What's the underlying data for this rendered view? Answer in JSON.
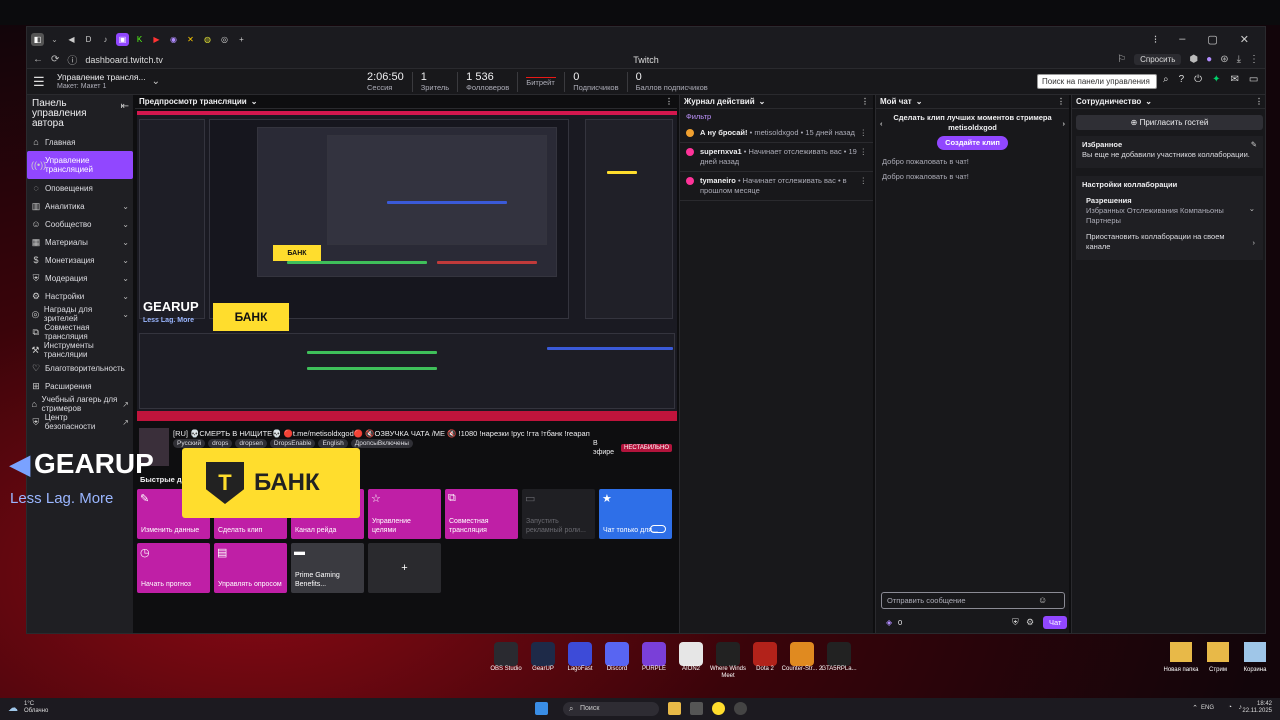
{
  "browser": {
    "url": "dashboard.twitch.tv",
    "title": "Twitch",
    "ask_label": "Спросить",
    "window_controls": [
      "⁝",
      "–",
      "▢",
      "✕"
    ]
  },
  "topbar": {
    "channel_name": "Управление трансля...",
    "channel_sub": "Макет: Макет 1",
    "stats": [
      {
        "value": "2:06:50",
        "label": "Сессия"
      },
      {
        "value": "1",
        "label": "Зритель"
      },
      {
        "value": "1 536",
        "label": "Фолловеров"
      },
      {
        "value": "",
        "label": "Битрейт"
      },
      {
        "value": "0",
        "label": "Подписчиков"
      },
      {
        "value": "0",
        "label": "Баллов подписчиков"
      }
    ],
    "search_placeholder": "Поиск на панели управления"
  },
  "sidebar": {
    "title": "Панель управления автора",
    "items": [
      {
        "label": "Главная",
        "icon": "home-icon",
        "glyph": "⌂",
        "chevron": false,
        "external": false
      },
      {
        "label": "Управление трансляцией",
        "icon": "broadcast-icon",
        "glyph": "((•))",
        "chevron": false,
        "external": false,
        "active": true
      },
      {
        "label": "Оповещения",
        "icon": "alert-icon",
        "glyph": "◌",
        "chevron": false,
        "external": false
      },
      {
        "label": "Аналитика",
        "icon": "analytics-icon",
        "glyph": "▥",
        "chevron": true,
        "external": false
      },
      {
        "label": "Сообщество",
        "icon": "community-icon",
        "glyph": "☺",
        "chevron": true,
        "external": false
      },
      {
        "label": "Материалы",
        "icon": "content-icon",
        "glyph": "▦",
        "chevron": true,
        "external": false
      },
      {
        "label": "Монетизация",
        "icon": "monetize-icon",
        "glyph": "$",
        "chevron": true,
        "external": false
      },
      {
        "label": "Модерация",
        "icon": "moderation-icon",
        "glyph": "⛨",
        "chevron": true,
        "external": false
      },
      {
        "label": "Настройки",
        "icon": "settings-icon",
        "glyph": "⚙",
        "chevron": true,
        "external": false
      },
      {
        "label": "Награды для зрителей",
        "icon": "rewards-icon",
        "glyph": "◎",
        "chevron": true,
        "external": false
      },
      {
        "label": "Совместная трансляция",
        "icon": "collab-icon",
        "glyph": "⧉",
        "chevron": false,
        "external": false
      },
      {
        "label": "Инструменты трансляции",
        "icon": "tools-icon",
        "glyph": "⚒",
        "chevron": false,
        "external": false
      },
      {
        "label": "Благотворительность",
        "icon": "charity-icon",
        "glyph": "♡",
        "chevron": false,
        "external": false
      },
      {
        "label": "Расширения",
        "icon": "extensions-icon",
        "glyph": "⊞",
        "chevron": false,
        "external": false
      },
      {
        "label": "Учебный лагерь для стримеров",
        "icon": "bootcamp-icon",
        "glyph": "⌂",
        "chevron": false,
        "external": true
      },
      {
        "label": "Центр безопасности",
        "icon": "safety-icon",
        "glyph": "⛨",
        "chevron": false,
        "external": true
      }
    ]
  },
  "preview": {
    "header": "Предпросмотр трансляции",
    "stream_title": "[RU] 💀СМЕРТЬ В НИЩИТЕ💀 🔴t.me/metisoldxgod🔴 🔇ОЗВУЧКА ЧАТА /МЕ 🔇 !1080 !нарезки !рус !гта !тбанк !геарап",
    "tags": [
      "Русский",
      "drops",
      "dropsen",
      "DropsEnable",
      "English",
      "ДропсыВключены"
    ],
    "status_line1": "В",
    "status_line2": "эфире",
    "unstable_label": "НЕСТАБИЛЬНО",
    "quick_actions_header": "Быстрые действия",
    "quick_actions": [
      {
        "label": "Изменить данные",
        "icon": "edit-icon",
        "glyph": "✎",
        "color": "#bf1fa6"
      },
      {
        "label": "Сделать клип",
        "icon": "clip-icon",
        "glyph": "✂",
        "color": "#bf1fa6"
      },
      {
        "label": "Канал рейда",
        "icon": "raid-icon",
        "glyph": "⇢",
        "color": "#bf1fa6"
      },
      {
        "label": "Управление целями",
        "icon": "goals-icon",
        "glyph": "☆",
        "color": "#bf1fa6"
      },
      {
        "label": "Совместная трансляция",
        "icon": "collab-icon",
        "glyph": "⧉",
        "color": "#bf1fa6"
      },
      {
        "label": "Запустить рекламный роли...",
        "icon": "ad-icon",
        "glyph": "▭",
        "color": "#1f1f23"
      },
      {
        "label": "Чат только для...",
        "icon": "star-icon",
        "glyph": "★",
        "color": "#2e6fe8"
      },
      {
        "label": "Начать прогноз",
        "icon": "prediction-icon",
        "glyph": "◷",
        "color": "#bf1fa6"
      },
      {
        "label": "Управлять опросом",
        "icon": "poll-icon",
        "glyph": "▤",
        "color": "#bf1fa6"
      },
      {
        "label": "Prime Gaming Benefits...",
        "icon": "prime-icon",
        "glyph": "▬",
        "color": "#3a3a40"
      },
      {
        "label": "+",
        "icon": "add-icon",
        "glyph": "+",
        "color": "#2a2a2e"
      }
    ]
  },
  "activity": {
    "header": "Журнал действий",
    "filter": "Фильтр",
    "items": [
      {
        "user": "А ну бросай!",
        "text": " • metisoldxgod • 15 дней назад",
        "icon_color": "#f0a030"
      },
      {
        "user": "supernxva1",
        "text": " • Начинает отслеживать вас • 19 дней назад",
        "icon_color": "#ff3399"
      },
      {
        "user": "tymaneiro",
        "text": " • Начинает отслеживать вас • в прошлом месяце",
        "icon_color": "#ff3399"
      }
    ]
  },
  "chat": {
    "header": "Мой чат",
    "clip_prompt": "Сделать клип лучших моментов стримера metisoldxgod",
    "clip_button": "Создайте клип",
    "welcome": [
      "Добро пожаловать в чат!",
      "Добро пожаловать в чат!"
    ],
    "input_placeholder": "Отправить сообщение",
    "points": "0",
    "send_label": "Чат"
  },
  "collab": {
    "header": "Сотрудничество",
    "invite": "Пригласить гостей",
    "favorites_title": "Избранное",
    "favorites_text": "Вы еще не добавили участников коллаборации.",
    "settings_title": "Настройки коллаборации",
    "perm_title": "Разрешения",
    "perm_text": "Избранных Отслеживания Компаньоны Партнеры",
    "pause_text": "Приостановить коллаборации на своем канале"
  },
  "overlay": {
    "gearup": "GEARUP",
    "gearup_slogan": "Less Lag. More",
    "tbank": "БАНК",
    "tbank_letter": "T"
  },
  "desktop": {
    "dock": [
      {
        "label": "OBS Studio",
        "color": "#2a2a30"
      },
      {
        "label": "GearUP",
        "color": "#1e2a48"
      },
      {
        "label": "LagoFast",
        "color": "#3d4bd8"
      },
      {
        "label": "Discord",
        "color": "#5865f2"
      },
      {
        "label": "PURPLE",
        "color": "#7a3fd8"
      },
      {
        "label": "AION2",
        "color": "#e6e6e6"
      },
      {
        "label": "Where Winds Meet",
        "color": "#222"
      },
      {
        "label": "Dota 2",
        "color": "#b2221a"
      },
      {
        "label": "Counter-Str... 2",
        "color": "#e08a20"
      },
      {
        "label": "GTA5RPLa...",
        "color": "#222"
      }
    ],
    "icons": [
      {
        "label": "Новая папка",
        "color": "#e8b948"
      },
      {
        "label": "Стрим",
        "color": "#e8b948"
      },
      {
        "label": "Корзина",
        "color": "#9fc6e8"
      }
    ]
  },
  "taskbar": {
    "temp": "1°C",
    "weather": "Облачно",
    "search": "Поиск",
    "lang": "ENG",
    "time": "18:42",
    "date": "22.11.2025"
  }
}
